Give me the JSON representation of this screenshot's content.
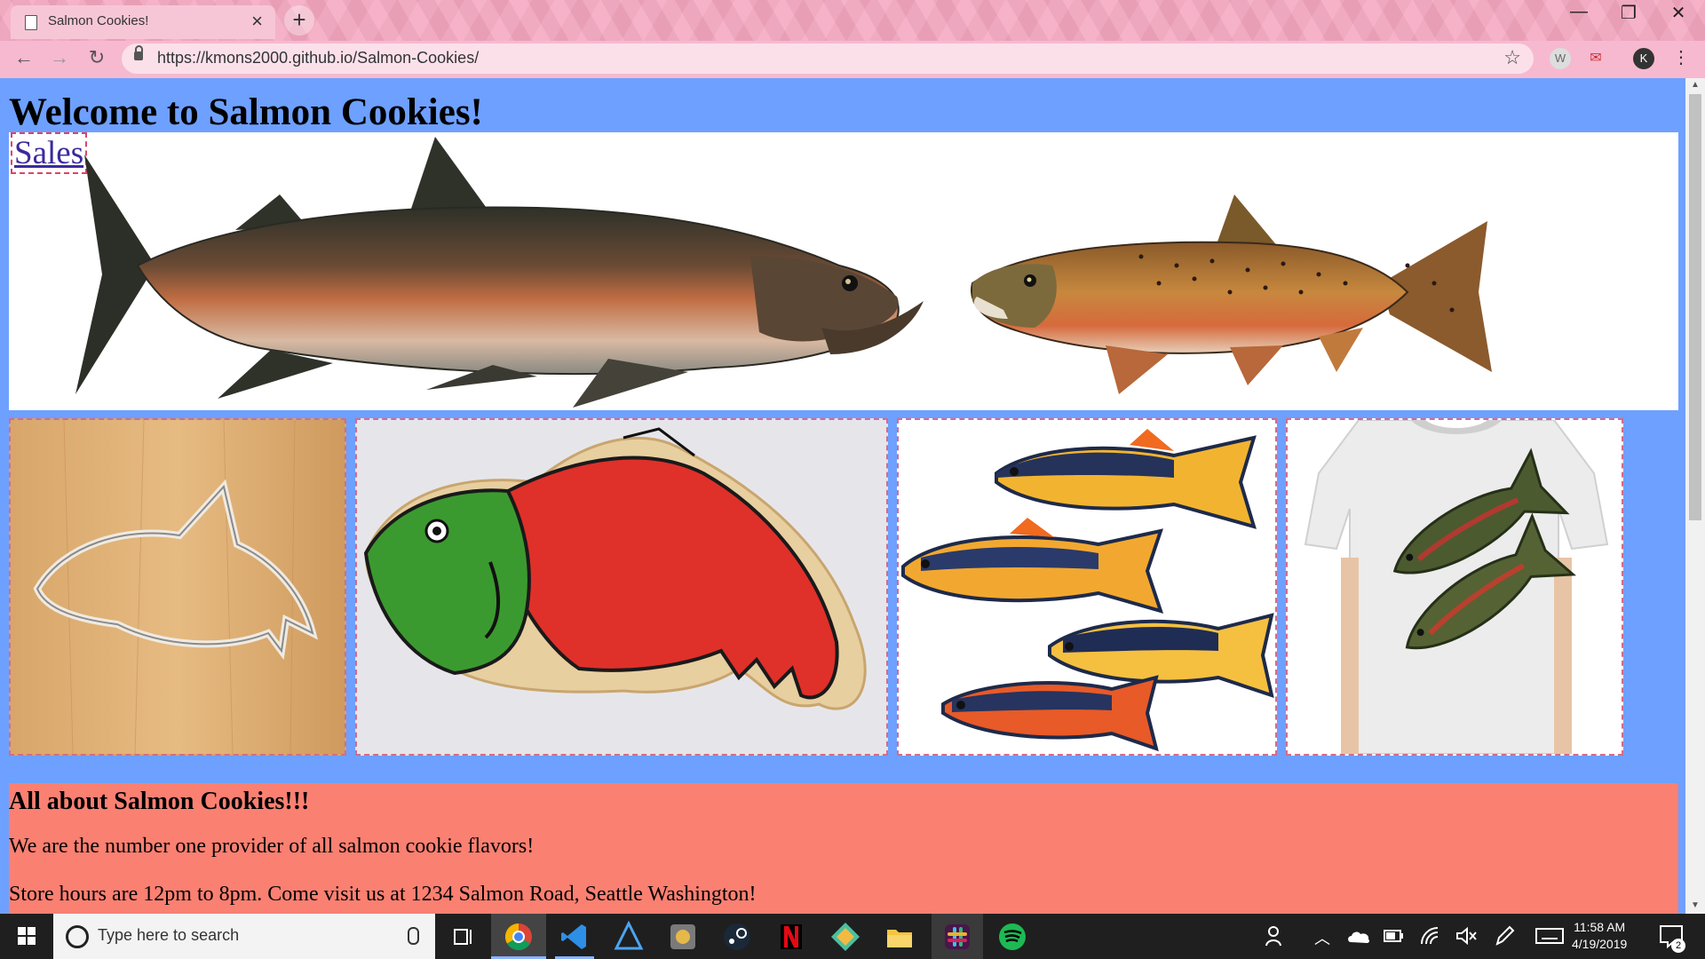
{
  "browser": {
    "tab_title": "Salmon Cookies!",
    "tab_close": "×",
    "new_tab": "+",
    "url": "https://kmons2000.github.io/Salmon-Cookies/",
    "window_controls": {
      "minimize": "—",
      "restore": "❐",
      "close": "✕"
    },
    "nav": {
      "back": "←",
      "forward": "→",
      "reload": "↻"
    },
    "bookmark_star": "☆",
    "extensions": [
      {
        "label": "W",
        "icon": "extension-w-icon"
      },
      {
        "label": "✉",
        "icon": "extension-mail-icon"
      },
      {
        "label": "K",
        "icon": "profile-avatar"
      }
    ],
    "menu": "⋮"
  },
  "page": {
    "title": "Welcome to Salmon Cookies!",
    "nav_link": "Sales",
    "about": {
      "heading": "All about Salmon Cookies!!!",
      "paragraphs": [
        "We are the number one provider of all salmon cookie flavors!",
        "Store hours are 12pm to 8pm. Come visit us at 1234 Salmon Road, Seattle Washington!"
      ]
    }
  },
  "taskbar": {
    "search_placeholder": "Type here to search",
    "time": "11:58 AM",
    "date": "4/19/2019",
    "notification_count": "2",
    "colors": {
      "background": "#1f1f1f",
      "accent": "#8cb4ff"
    }
  }
}
